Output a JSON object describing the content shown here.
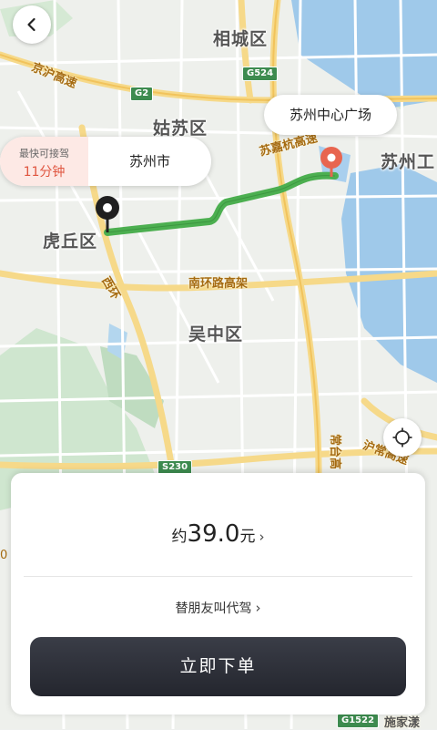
{
  "map": {
    "districts": [
      "相城区",
      "姑苏区",
      "虎丘区",
      "吴中区",
      "苏州工"
    ],
    "roads": [
      "京沪高速",
      "苏嘉杭高速",
      "南环路高架",
      "西环",
      "常台高",
      "沪常高速",
      "施家漾"
    ],
    "shields": [
      "G524",
      "G2",
      "S230",
      "G1522"
    ],
    "edge_text": "0"
  },
  "route": {
    "origin": "苏州市",
    "destination": "苏州中心广场",
    "eta_label": "最快可接驾",
    "eta_value": "11分钟",
    "route_color": "#4caf50",
    "dest_pin_color": "#e8654f"
  },
  "icons": {
    "back": "back-arrow-icon",
    "locate": "locate-icon",
    "origin_pin": "origin-pin-icon",
    "destination_pin": "destination-pin-icon"
  },
  "panel": {
    "price_prefix": "约",
    "price_value": "39.0",
    "price_unit": "元",
    "price_chevron": "›",
    "friend_text": "替朋友叫代驾",
    "friend_chevron": "›",
    "order_button": "立即下单"
  }
}
